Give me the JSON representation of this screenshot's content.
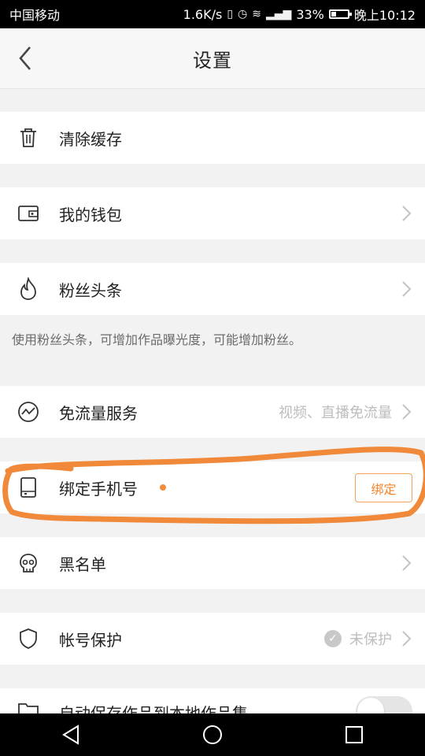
{
  "status_bar": {
    "carrier": "中国移动",
    "speed": "1.6K/s",
    "battery_percent": "33%",
    "time": "晚上10:12",
    "icons": [
      "vibrate-icon",
      "alarm-icon",
      "wifi-icon",
      "signal-icon",
      "battery-icon"
    ]
  },
  "header": {
    "title": "设置",
    "back_icon": "chevron-left-icon"
  },
  "rows": {
    "clear_cache": {
      "label": "清除缓存",
      "icon": "trash-icon"
    },
    "wallet": {
      "label": "我的钱包",
      "icon": "wallet-icon"
    },
    "fans_headline": {
      "label": "粉丝头条",
      "icon": "flame-icon",
      "note": "使用粉丝头条，可增加作品曝光度，可能增加粉丝。"
    },
    "free_data": {
      "label": "免流量服务",
      "icon": "chart-icon",
      "value": "视频、直播免流量"
    },
    "bind_phone": {
      "label": "绑定手机号",
      "icon": "phone-icon",
      "button": "绑定"
    },
    "blacklist": {
      "label": "黑名单",
      "icon": "skull-icon"
    },
    "account_protect": {
      "label": "帐号保护",
      "icon": "shield-icon",
      "value": "未保护"
    },
    "auto_save": {
      "label": "自动保存作品到本地作品集",
      "icon": "folder-icon"
    }
  },
  "annotation": {
    "color": "#f0893a"
  },
  "colors": {
    "accent": "#f2852c",
    "muted": "#bdbdbd"
  }
}
